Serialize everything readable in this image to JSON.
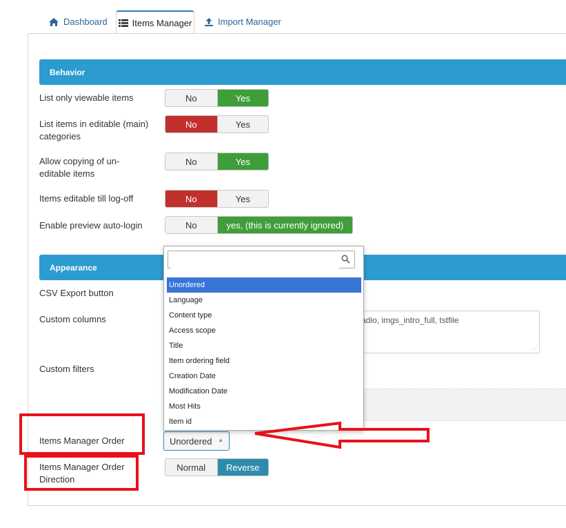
{
  "tabs": {
    "dashboard": "Dashboard",
    "items_manager": "Items Manager",
    "import_manager": "Import Manager"
  },
  "behavior": {
    "header": "Behavior",
    "rows": [
      {
        "label": "List only viewable items",
        "no": "No",
        "yes": "Yes",
        "selected": "yes"
      },
      {
        "label": "List items in editable (main) categories",
        "no": "No",
        "yes": "Yes",
        "selected": "no"
      },
      {
        "label": "Allow copying of un-editable items",
        "no": "No",
        "yes": "Yes",
        "selected": "yes"
      },
      {
        "label": "Items editable till log-off",
        "no": "No",
        "yes": "Yes",
        "selected": "no"
      },
      {
        "label": "Enable preview auto-login",
        "no": "No",
        "yes": "yes, (this is currently ignored)",
        "selected": "yes"
      }
    ]
  },
  "appearance": {
    "header": "Appearance",
    "csv_label": "CSV Export button",
    "custom_columns_label": "Custom columns",
    "custom_columns_value": "adio, imgs_intro_full, tstfile",
    "custom_filters_label": "Custom filters",
    "order_label": "Items Manager Order",
    "order_value": "Unordered",
    "direction_label": "Items Manager Order Direction",
    "direction_normal": "Normal",
    "direction_reverse": "Reverse",
    "direction_selected": "reverse"
  },
  "dropdown": {
    "search_placeholder": "",
    "options": [
      "Unordered",
      "Language",
      "Content type",
      "Access scope",
      "Title",
      "Item ordering field",
      "Creation Date",
      "Modification Date",
      "Most Hits",
      "Item id"
    ],
    "selected": "Unordered"
  },
  "icons": {
    "dashboard": "home-icon",
    "items_manager": "list-icon",
    "import_manager": "upload-icon",
    "search": "search-icon",
    "caret": "caret-up-icon"
  },
  "colors": {
    "section_header": "#2b9bd0",
    "yes_green": "#3f9e3a",
    "no_red": "#c1302d",
    "reverse_blue": "#2d8cad",
    "annotation_red": "#e8101a",
    "selected_option": "#3875d7"
  }
}
